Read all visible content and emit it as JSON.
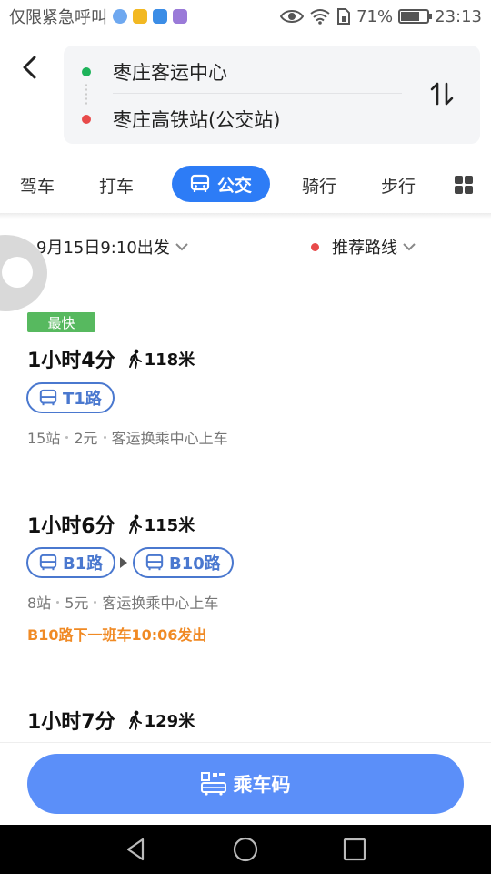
{
  "status_bar": {
    "notification_text": "仅限紧急呼叫",
    "battery": "71%",
    "battery_level": 0.71,
    "time": "23:13"
  },
  "route": {
    "origin": "枣庄客运中心",
    "destination": "枣庄高铁站(公交站)"
  },
  "tabs": {
    "drive": "驾车",
    "taxi": "打车",
    "bus": "公交",
    "cycle": "骑行",
    "walk": "步行"
  },
  "filters": {
    "departure": "9月15日9:10出发",
    "strategy": "推荐路线"
  },
  "routes": [
    {
      "badge": "最快",
      "duration": "1小时4分",
      "walk": "118米",
      "lines": [
        "T1路"
      ],
      "stops": "15站",
      "fare": "2元",
      "boarding": "客运换乘中心上车"
    },
    {
      "duration": "1小时6分",
      "walk": "115米",
      "lines": [
        "B1路",
        "B10路"
      ],
      "stops": "8站",
      "fare": "5元",
      "boarding": "客运换乘中心上车",
      "notice": "B10路下一班车10:06发出"
    },
    {
      "duration": "1小时7分",
      "walk": "129米"
    }
  ],
  "bottom": {
    "ride_code": "乘车码"
  },
  "colors": {
    "accent": "#2d7cf6",
    "button": "#5b8ff9",
    "fastest_badge": "#57b95f",
    "origin_dot": "#1db35a",
    "destination_dot": "#e84a4a",
    "notice": "#f08a24"
  }
}
